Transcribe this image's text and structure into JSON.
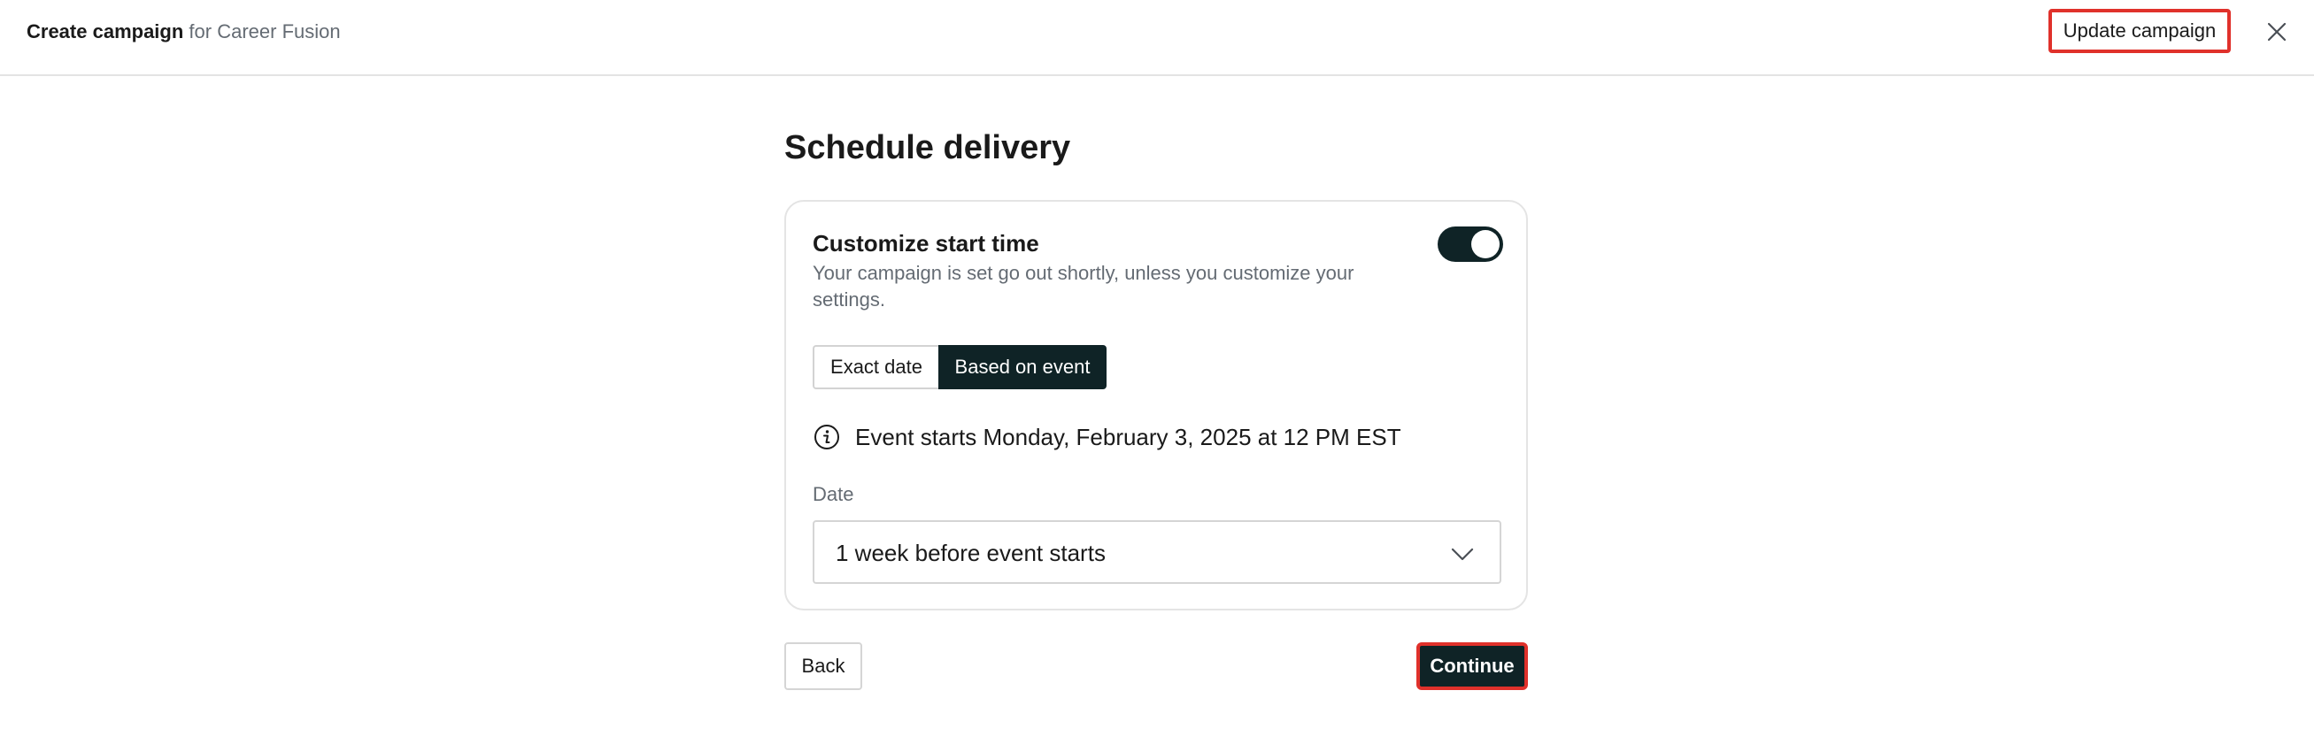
{
  "header": {
    "title_strong": "Create campaign",
    "title_muted": "for Career Fusion",
    "update_label": "Update campaign",
    "close_icon": "close-icon"
  },
  "main": {
    "heading": "Schedule delivery"
  },
  "card": {
    "title": "Customize start time",
    "description": "Your campaign is set go out shortly, unless you customize your settings.",
    "toggle_on": true,
    "segments": [
      {
        "label": "Exact date",
        "selected": false
      },
      {
        "label": "Based on event",
        "selected": true
      }
    ],
    "info_icon": "info-icon",
    "info_text": "Event starts Monday, February 3, 2025 at 12 PM EST",
    "date_label": "Date",
    "date_value": "1 week before event starts",
    "chevron_icon": "chevron-down-icon"
  },
  "footer": {
    "back_label": "Back",
    "continue_label": "Continue"
  },
  "colors": {
    "dark": "#0f2326",
    "highlight": "#e0312b",
    "muted_text": "#646b73"
  }
}
